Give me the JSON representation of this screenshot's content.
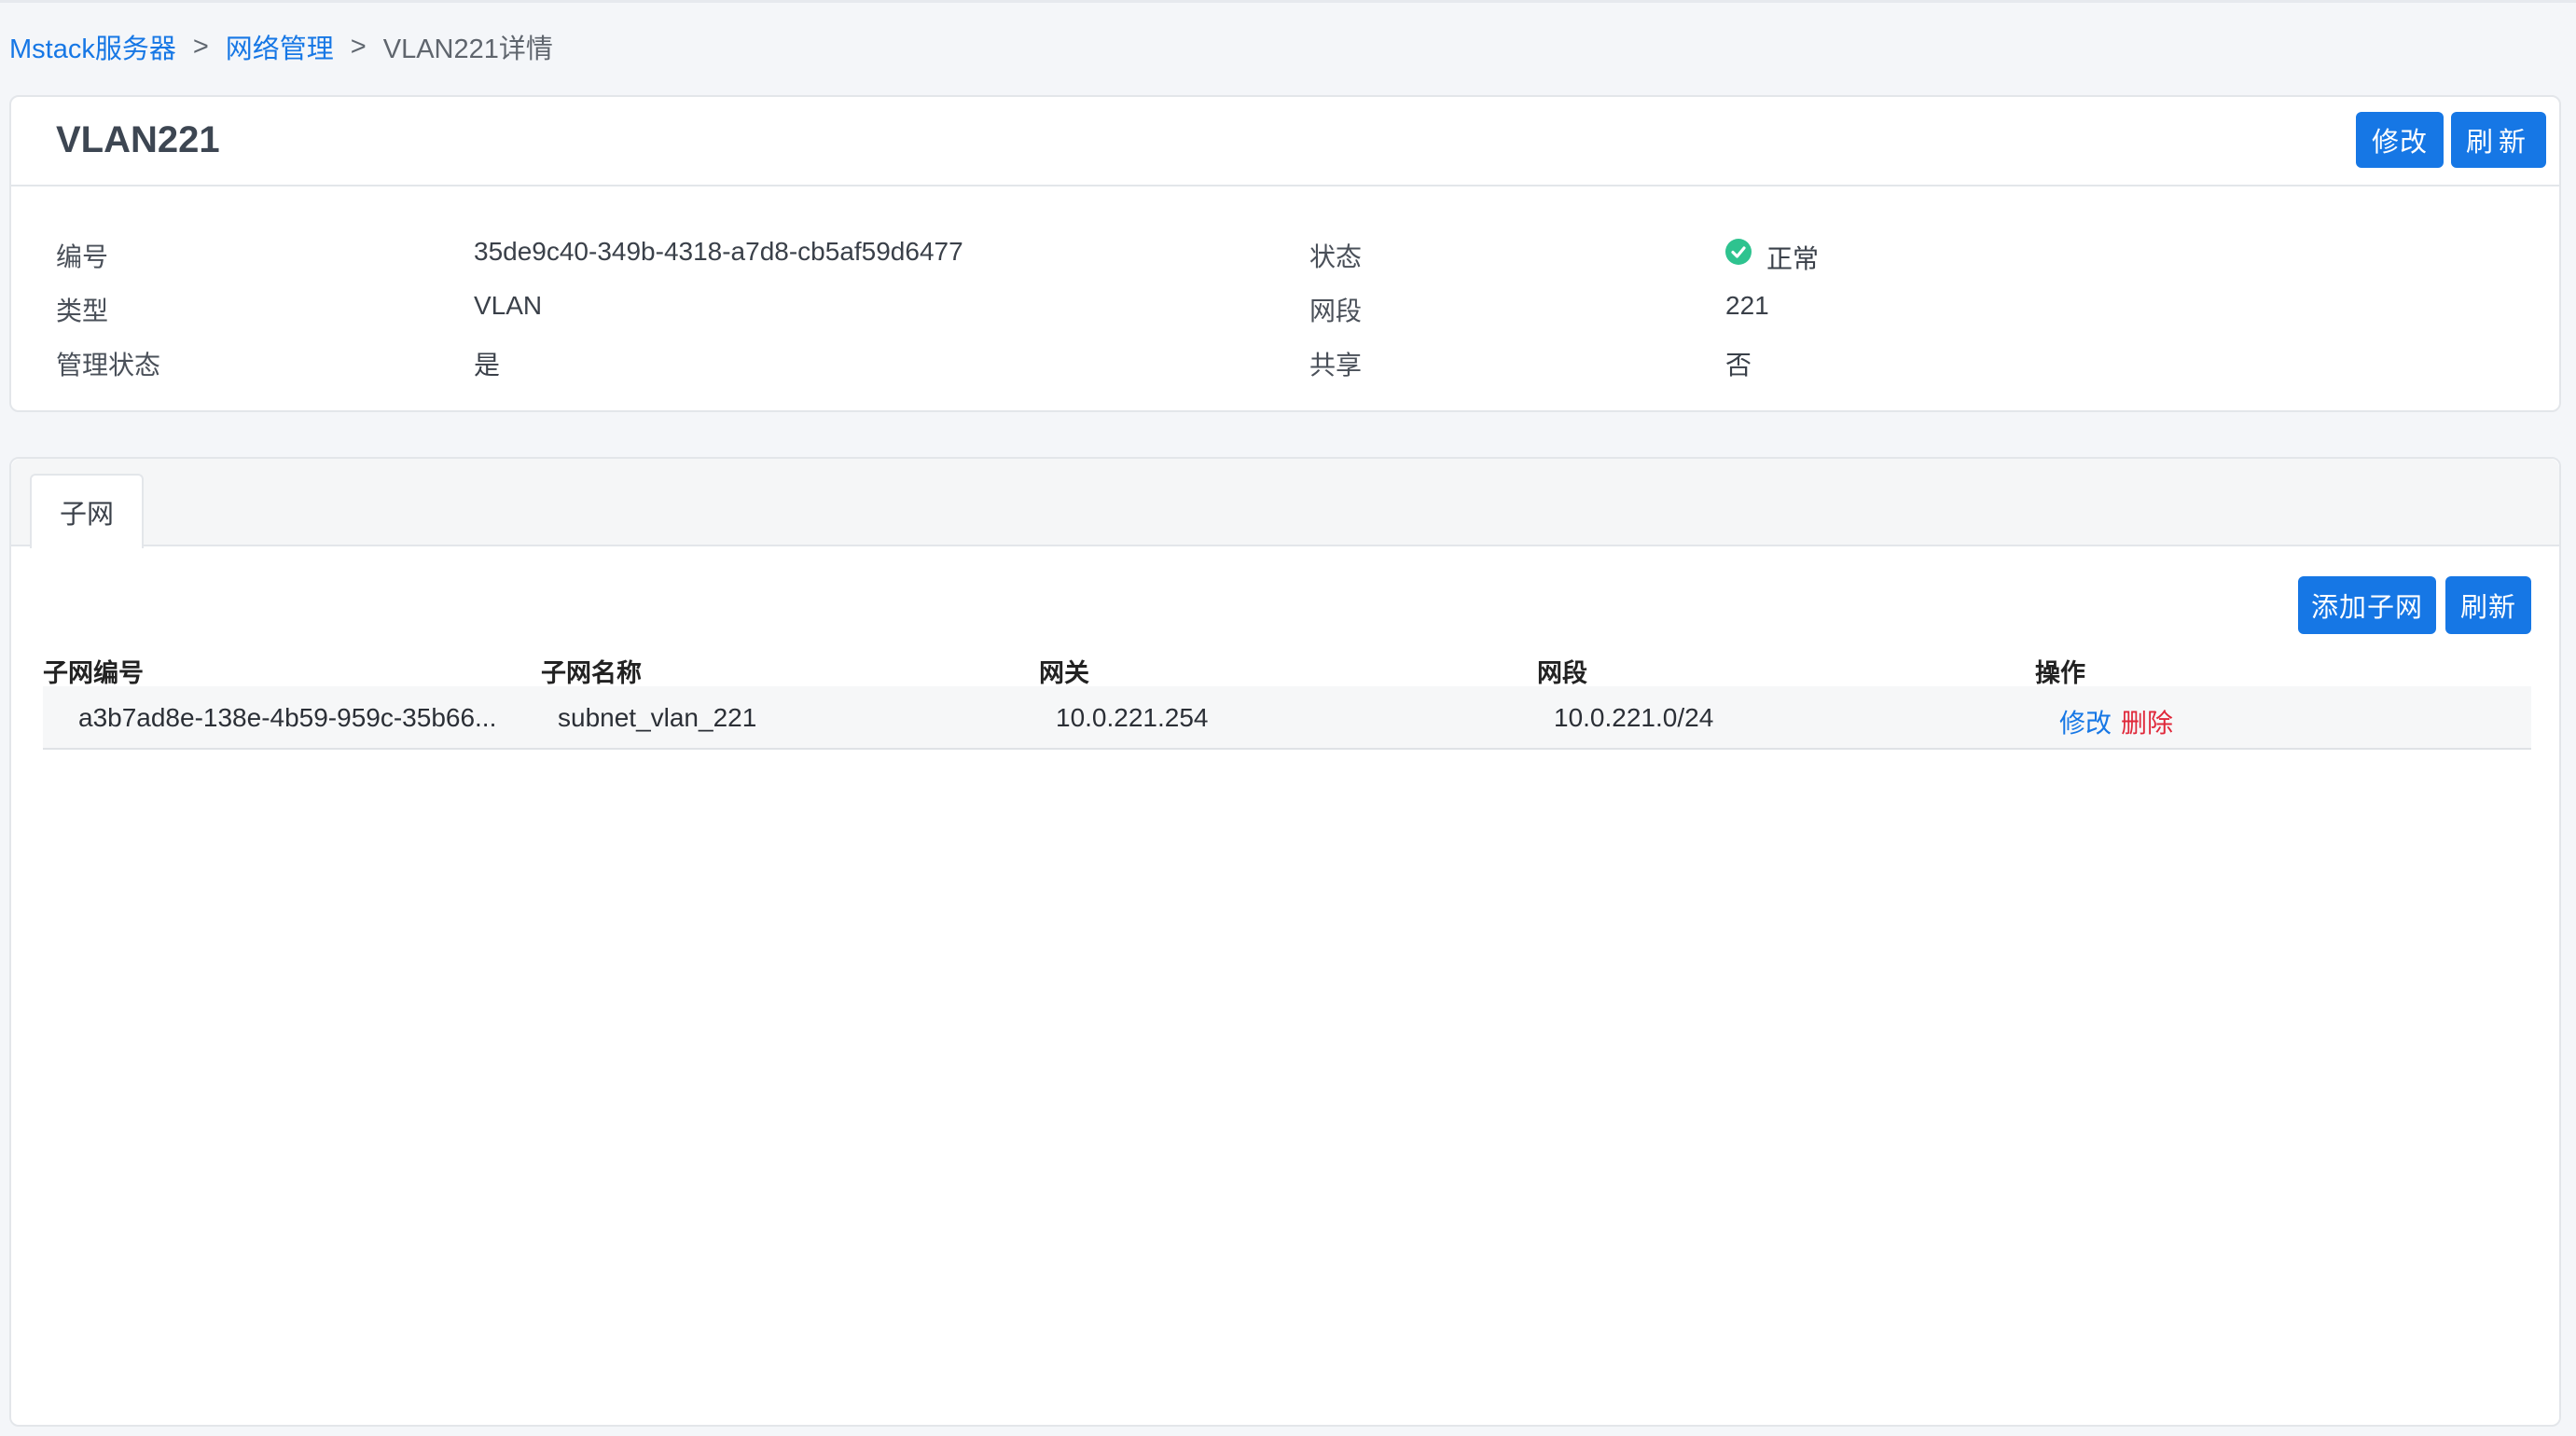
{
  "breadcrumb": {
    "root": "Mstack服务器",
    "sep": ">",
    "section": "网络管理",
    "current": "VLAN221详情"
  },
  "info": {
    "title": "VLAN221",
    "edit_label": "修改",
    "refresh_label": "刷新",
    "fields": {
      "id_label": "编号",
      "id_value": "35de9c40-349b-4318-a7d8-cb5af59d6477",
      "status_label": "状态",
      "status_value": "正常",
      "type_label": "类型",
      "type_value": "VLAN",
      "segment_label": "网段",
      "segment_value": "221",
      "admin_state_label": "管理状态",
      "admin_state_value": "是",
      "shared_label": "共享",
      "shared_value": "否"
    },
    "status_color": "#2ec38f"
  },
  "tabs": [
    {
      "label": "子网",
      "active": true
    }
  ],
  "subnet_toolbar": {
    "add_label": "添加子网",
    "refresh_label": "刷新"
  },
  "subnet_table": {
    "columns": [
      "子网编号",
      "子网名称",
      "网关",
      "网段",
      "操作"
    ],
    "rows": [
      {
        "id": "a3b7ad8e-138e-4b59-959c-35b66...",
        "name": "subnet_vlan_221",
        "gateway": "10.0.221.254",
        "cidr": "10.0.221.0/24",
        "edit": "修改",
        "delete": "删除"
      }
    ]
  },
  "colors": {
    "primary": "#1677e5",
    "danger": "#e0283a",
    "success": "#2ec38f"
  }
}
